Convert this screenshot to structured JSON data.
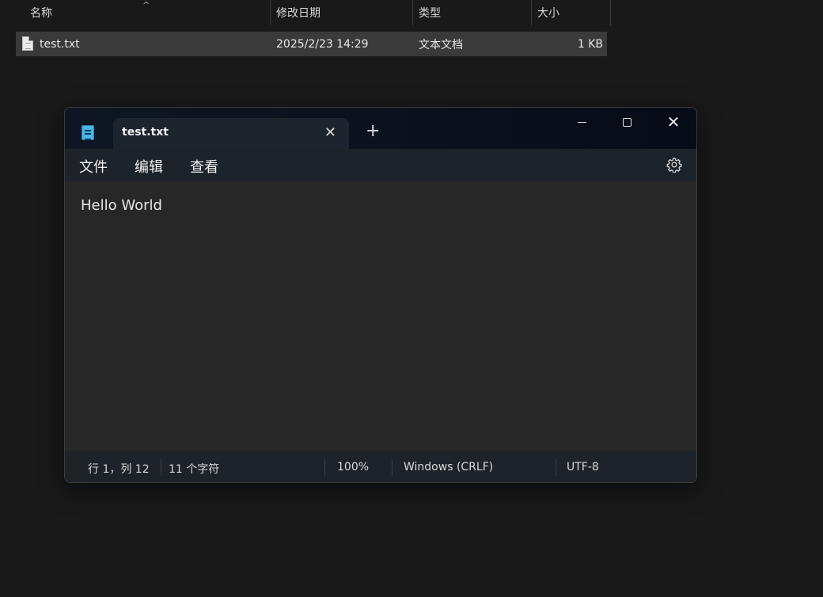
{
  "explorer": {
    "columns": {
      "name": "名称",
      "modified": "修改日期",
      "type": "类型",
      "size": "大小"
    },
    "sort_indicator": "^",
    "files": [
      {
        "name": "test.txt",
        "modified": "2025/2/23 14:29",
        "type": "文本文档",
        "size": "1 KB"
      }
    ]
  },
  "notepad": {
    "tab_title": "test.txt",
    "tab_close": "✕",
    "new_tab": "+",
    "close_glyph": "✕",
    "menu": {
      "file": "文件",
      "edit": "编辑",
      "view": "查看"
    },
    "content": "Hello World",
    "status": {
      "position": "行 1，列 12",
      "char_count": "11 个字符",
      "zoom": "100%",
      "line_ending": "Windows (CRLF)",
      "encoding": "UTF-8"
    }
  },
  "colors": {
    "desktop_bg": "#191919",
    "titlebar_bg": "#0b1320",
    "editor_bg": "#272727",
    "app_icon": "#48b7e6"
  }
}
